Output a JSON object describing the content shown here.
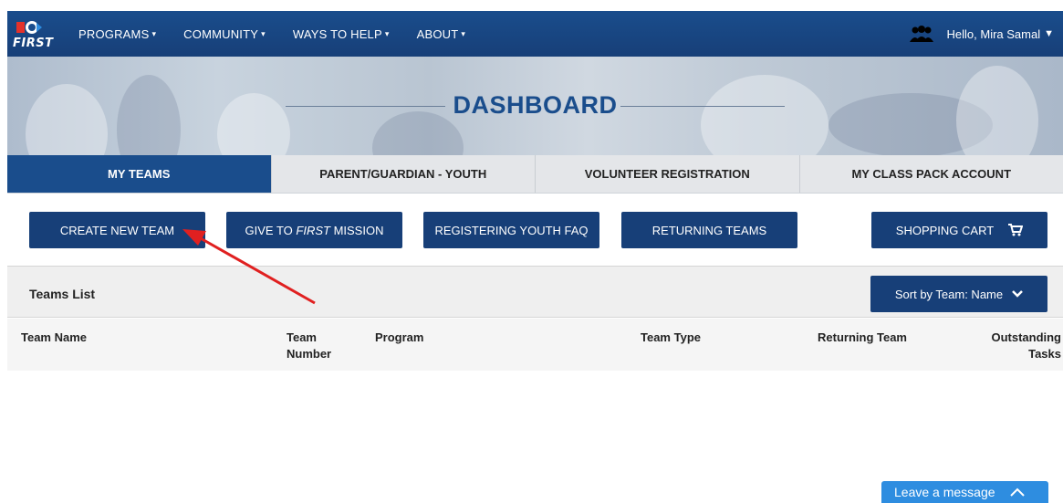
{
  "logo": {
    "wordmark": "FIRST"
  },
  "nav": {
    "items": [
      {
        "label": "PROGRAMS"
      },
      {
        "label": "COMMUNITY"
      },
      {
        "label": "WAYS TO HELP"
      },
      {
        "label": "ABOUT"
      }
    ],
    "caret": "▾",
    "user_greeting": "Hello, Mira Samal",
    "user_caret": "▼",
    "user_icon": "people-icon"
  },
  "hero": {
    "title": "DASHBOARD"
  },
  "tabs": [
    {
      "label": "MY TEAMS",
      "active": true
    },
    {
      "label": "PARENT/GUARDIAN - YOUTH",
      "active": false
    },
    {
      "label": "VOLUNTEER REGISTRATION",
      "active": false
    },
    {
      "label": "MY CLASS PACK ACCOUNT",
      "active": false
    }
  ],
  "actions": {
    "create_new_team": "CREATE NEW TEAM",
    "give_prefix": "GIVE TO ",
    "give_emphasis": "FIRST",
    "give_suffix": " MISSION",
    "registering_faq": "REGISTERING YOUTH FAQ",
    "returning_teams": "RETURNING TEAMS",
    "shopping_cart": "SHOPPING CART",
    "cart_icon": "cart-icon"
  },
  "teams_list": {
    "title": "Teams List",
    "sort_label": "Sort by Team: Name",
    "columns": {
      "team_name": "Team Name",
      "team_number_1": "Team",
      "team_number_2": "Number",
      "program": "Program",
      "team_type": "Team Type",
      "returning_team": "Returning Team",
      "outstanding_1": "Outstanding",
      "outstanding_2": "Tasks"
    }
  },
  "chat": {
    "label": "Leave a message"
  },
  "colors": {
    "brand_blue": "#173f78",
    "tab_active": "#1a4d8c",
    "chat_blue": "#2e8de0",
    "annotation_red": "#e02020"
  }
}
